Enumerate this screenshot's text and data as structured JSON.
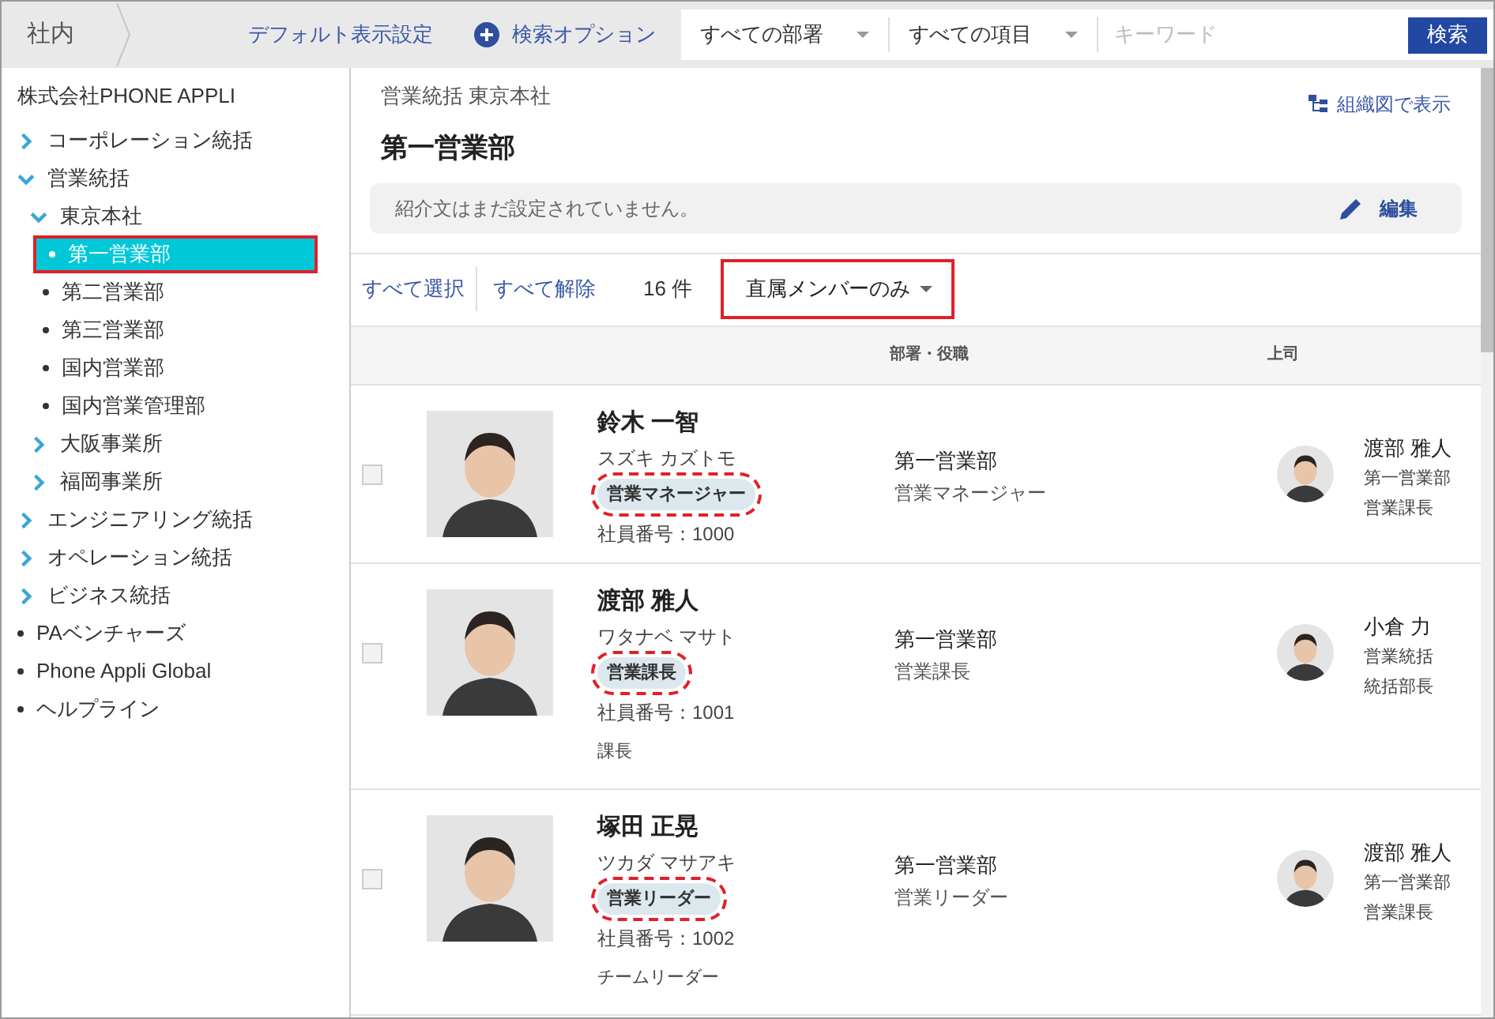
{
  "topbar": {
    "scope": "社内",
    "default_view": "デフォルト表示設定",
    "search_options": "検索オプション",
    "dept_select": "すべての部署",
    "field_select": "すべての項目",
    "keyword_placeholder": "キーワード",
    "search_button": "検索"
  },
  "sidebar": {
    "company": "株式会社PHONE APPLI",
    "items": [
      {
        "label": "コーポレーション統括",
        "kind": "branch",
        "expanded": false,
        "selected": false
      },
      {
        "label": "営業統括",
        "kind": "branch",
        "expanded": true,
        "selected": false,
        "children": [
          {
            "label": "東京本社",
            "kind": "branch",
            "expanded": true,
            "selected": false,
            "children": [
              {
                "label": "第一営業部",
                "kind": "leaf",
                "selected": true
              },
              {
                "label": "第二営業部",
                "kind": "leaf",
                "selected": false
              },
              {
                "label": "第三営業部",
                "kind": "leaf",
                "selected": false
              },
              {
                "label": "国内営業部",
                "kind": "leaf",
                "selected": false
              },
              {
                "label": "国内営業管理部",
                "kind": "leaf",
                "selected": false
              }
            ]
          },
          {
            "label": "大阪事業所",
            "kind": "branch",
            "expanded": false,
            "selected": false
          },
          {
            "label": "福岡事業所",
            "kind": "branch",
            "expanded": false,
            "selected": false
          }
        ]
      },
      {
        "label": "エンジニアリング統括",
        "kind": "branch",
        "expanded": false,
        "selected": false
      },
      {
        "label": "オペレーション統括",
        "kind": "branch",
        "expanded": false,
        "selected": false
      },
      {
        "label": "ビジネス統括",
        "kind": "branch",
        "expanded": false,
        "selected": false
      },
      {
        "label": "PAベンチャーズ",
        "kind": "leaf",
        "selected": false
      },
      {
        "label": "Phone Appli Global",
        "kind": "leaf",
        "selected": false
      },
      {
        "label": "ヘルプライン",
        "kind": "leaf",
        "selected": false
      }
    ]
  },
  "header": {
    "breadcrumb": "営業統括 東京本社",
    "title": "第一営業部",
    "org_chart_link": "組織図で表示",
    "intro": "紹介文はまだ設定されていません。",
    "edit": "編集"
  },
  "toolbar": {
    "select_all": "すべて選択",
    "deselect_all": "すべて解除",
    "count": "16 件",
    "filter": {
      "value": "直属メンバーのみ",
      "highlighted": true
    }
  },
  "table": {
    "columns": [
      "部署・役職",
      "上司"
    ],
    "rows": [
      {
        "checked": false,
        "name": "鈴木 一智",
        "kana": "スズキ カズトモ",
        "badge": {
          "text": "営業マネージャー",
          "highlighted": true
        },
        "employee_no": "社員番号：1000",
        "dept": "第一営業部",
        "role": "営業マネージャー",
        "boss": {
          "name": "渡部 雅人",
          "dept": "第一営業部",
          "role": "営業課長"
        }
      },
      {
        "checked": false,
        "name": "渡部 雅人",
        "kana": "ワタナベ マサト",
        "badge": {
          "text": "営業課長",
          "highlighted": true
        },
        "employee_no": "社員番号：1001",
        "title": "課長",
        "dept": "第一営業部",
        "role": "営業課長",
        "boss": {
          "name": "小倉 力",
          "dept": "営業統括",
          "role": "統括部長"
        }
      },
      {
        "checked": false,
        "name": "塚田 正晃",
        "kana": "ツカダ マサアキ",
        "badge": {
          "text": "営業リーダー",
          "highlighted": true
        },
        "employee_no": "社員番号：1002",
        "title": "チームリーダー",
        "dept": "第一営業部",
        "role": "営業リーダー",
        "boss": {
          "name": "渡部 雅人",
          "dept": "第一営業部",
          "role": "営業課長"
        }
      }
    ]
  }
}
